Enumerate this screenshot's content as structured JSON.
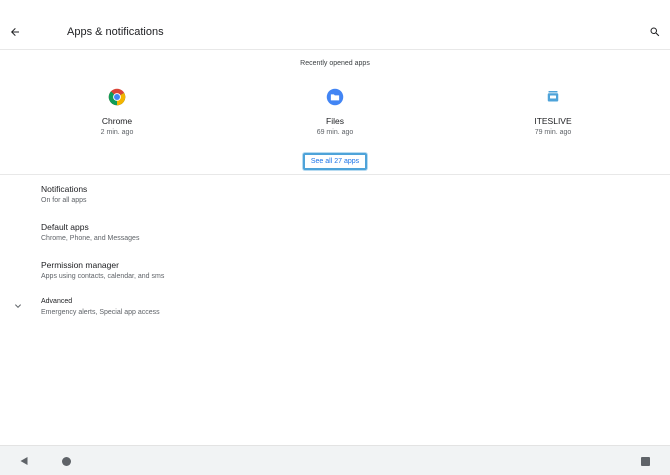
{
  "appbar": {
    "title": "Apps & notifications",
    "back_icon": "arrow-back-icon",
    "search_icon": "search-icon"
  },
  "recent": {
    "header": "Recently opened apps",
    "apps": [
      {
        "name": "Chrome",
        "time": "2 min. ago",
        "icon": "chrome-icon"
      },
      {
        "name": "Files",
        "time": "69 min. ago",
        "icon": "files-icon"
      },
      {
        "name": "ITESLIVE",
        "time": "79 min. ago",
        "icon": "iteslive-icon"
      }
    ],
    "see_all_label": "See all 27 apps"
  },
  "preferences": [
    {
      "title": "Notifications",
      "summary": "On for all apps"
    },
    {
      "title": "Default apps",
      "summary": "Chrome, Phone, and Messages"
    },
    {
      "title": "Permission manager",
      "summary": "Apps using contacts, calendar, and sms"
    },
    {
      "title": "Advanced",
      "summary": "Emergency alerts, Special app access",
      "icon": "chevron-down-icon"
    }
  ],
  "navbar": {
    "back_icon": "nav-back-icon",
    "home_icon": "nav-home-icon",
    "recents_icon": "nav-recents-icon"
  },
  "colors": {
    "accent": "#1a73e8",
    "focus_ring": "#4ea3d9",
    "text_primary": "#202124",
    "text_secondary": "#5f6368"
  }
}
